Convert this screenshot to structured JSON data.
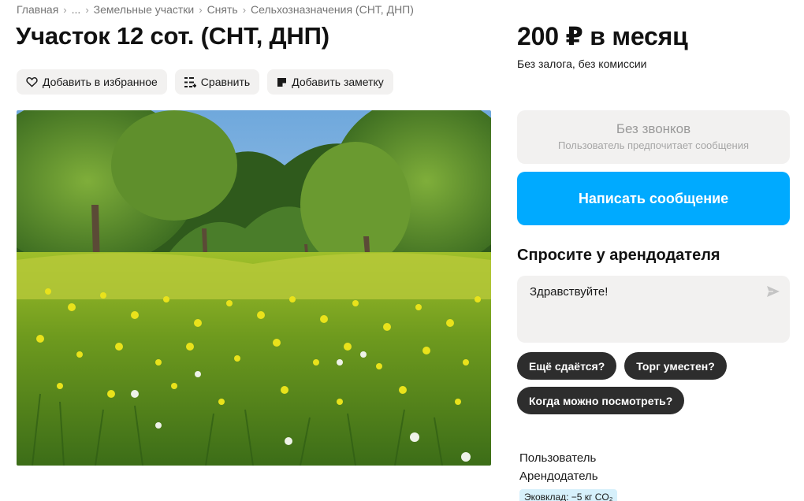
{
  "breadcrumb": {
    "items": [
      "Главная",
      "...",
      "Земельные участки",
      "Снять",
      "Сельхозназначения (СНТ, ДНП)"
    ],
    "separator": "›"
  },
  "listing": {
    "title": "Участок 12 сот. (СНТ, ДНП)"
  },
  "actions": {
    "favorite_label": "Добавить в избранное",
    "compare_label": "Сравнить",
    "note_label": "Добавить заметку"
  },
  "photo": {
    "description_icon": "landscape-photo"
  },
  "pricing": {
    "price": "200 ₽ в месяц",
    "note": "Без залога, без комиссии"
  },
  "contact": {
    "no_calls_title": "Без звонков",
    "no_calls_subtitle": "Пользователь предпочитает сообщения",
    "write_label": "Написать сообщение"
  },
  "ask": {
    "heading": "Спросите у арендодателя",
    "message_value": "Здравствуйте!",
    "quick_questions": [
      "Ещё сдаётся?",
      "Торг уместен?",
      "Когда можно посмотреть?"
    ]
  },
  "seller": {
    "name": "Пользователь",
    "role": "Арендодатель",
    "eco_badge": "Эковклад: −5 кг CO₂"
  },
  "colors": {
    "accent": "#00aaff",
    "chip": "#2d2d2d",
    "surface": "#f2f1f0",
    "eco": "#d6f0fb"
  }
}
